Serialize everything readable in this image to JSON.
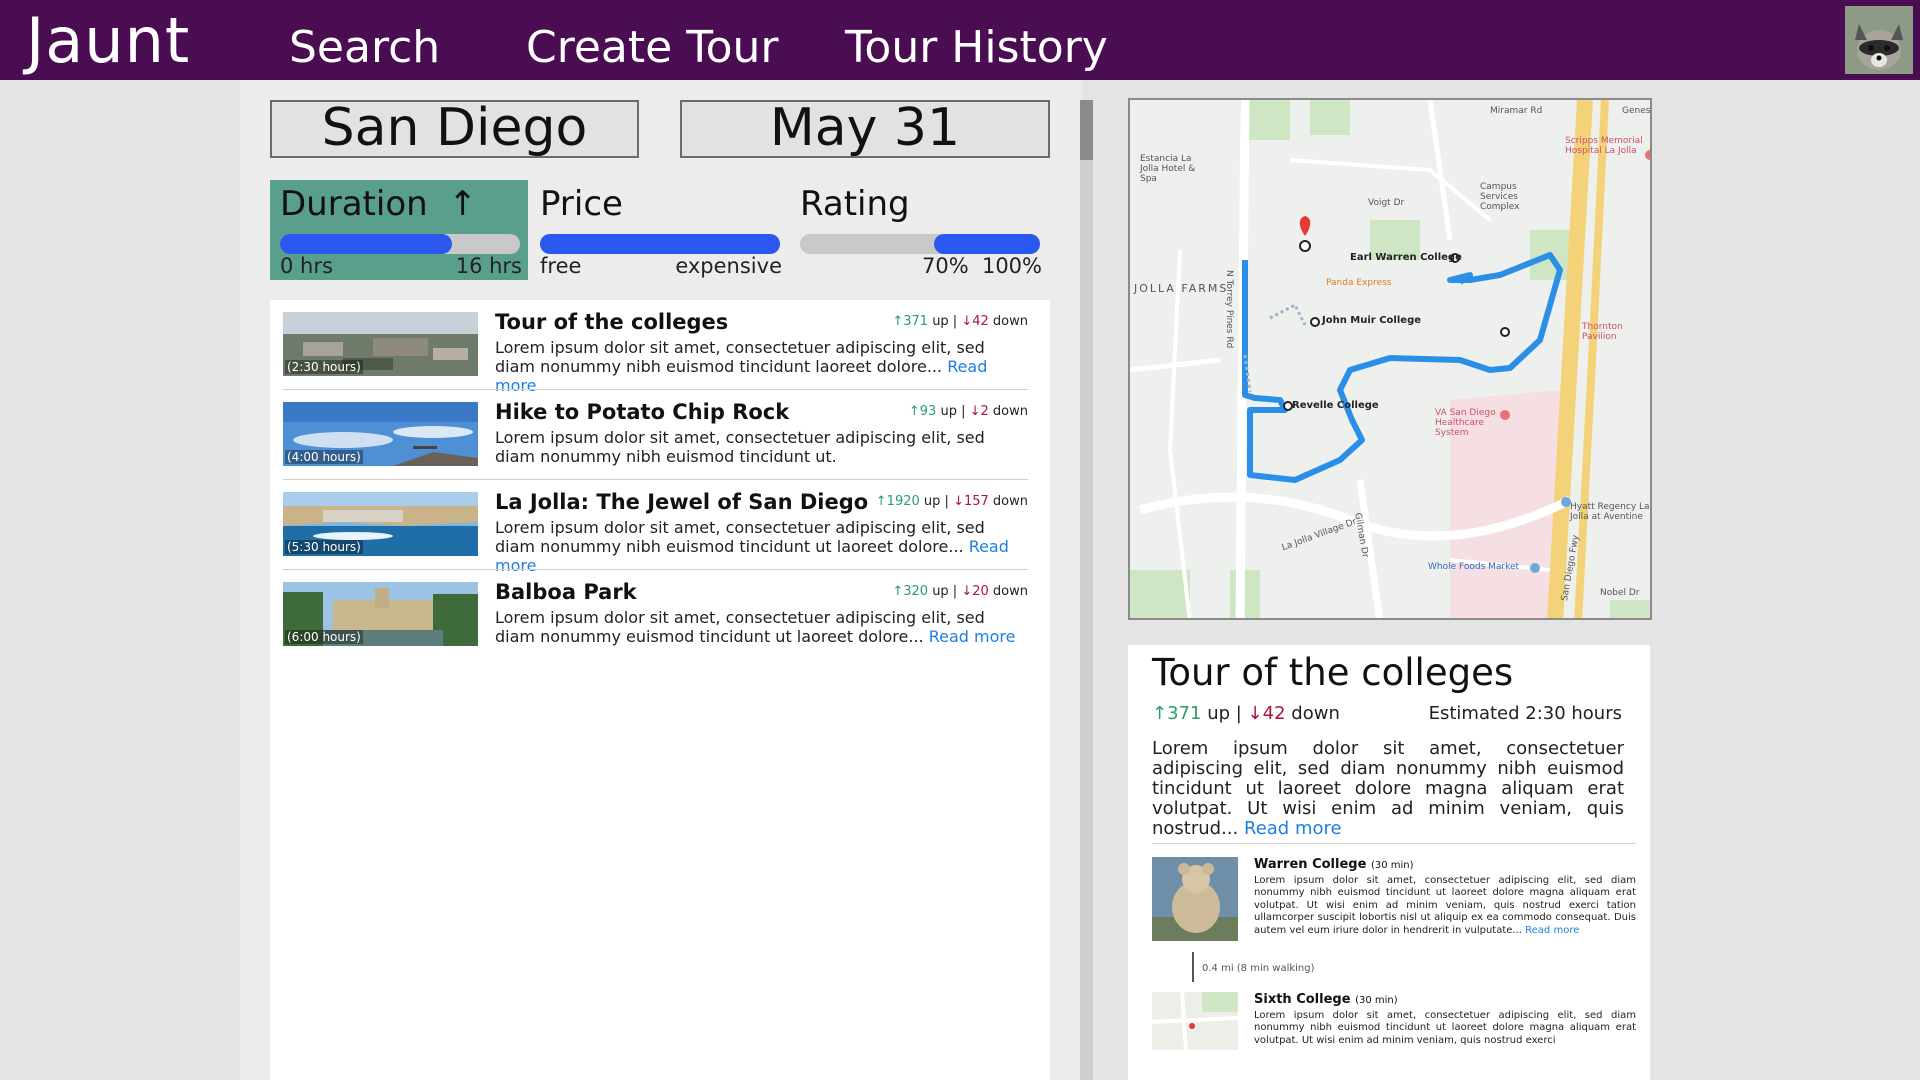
{
  "header": {
    "logo": "Jaunt",
    "nav": [
      "Search",
      "Create Tour",
      "Tour History"
    ]
  },
  "search": {
    "city": "San Diego",
    "date": "May 31"
  },
  "filters": {
    "duration": {
      "label": "Duration",
      "sort_icon": "arrow-up-icon",
      "min_label": "0 hrs",
      "max_label": "16 hrs",
      "range": [
        0,
        0.72
      ],
      "active": true
    },
    "price": {
      "label": "Price",
      "min_label": "free",
      "max_label": "expensive",
      "range": [
        0,
        1
      ]
    },
    "rating": {
      "label": "Rating",
      "min_label": "70%",
      "max_label": "100%",
      "range": [
        0.55,
        1
      ]
    }
  },
  "results": [
    {
      "title": "Tour of the colleges",
      "duration": "(2:30 hours)",
      "up": "↑371",
      "down": "↓42",
      "up_word": "up |",
      "down_word": "down",
      "desc": "Lorem ipsum dolor sit amet, consectetuer adipiscing elit, sed diam nonummy nibh euismod tincidunt laoreet dolore...",
      "read_more": "Read more"
    },
    {
      "title": "Hike to Potato Chip Rock",
      "duration": "(4:00 hours)",
      "up": "↑93",
      "down": "↓2",
      "up_word": "up |",
      "down_word": "down",
      "desc": "Lorem ipsum dolor sit amet, consectetuer adipiscing elit, sed diam nonummy nibh euismod tincidunt ut.",
      "read_more": ""
    },
    {
      "title": "La Jolla: The Jewel of San Diego",
      "duration": "(5:30 hours)",
      "up": "↑1920",
      "down": "↓157",
      "up_word": "up |",
      "down_word": "down",
      "desc": "Lorem ipsum dolor sit amet, consectetuer adipiscing elit, sed diam nonummy nibh euismod tincidunt ut laoreet dolore...",
      "read_more": "Read more"
    },
    {
      "title": "Balboa Park",
      "duration": "(6:00 hours)",
      "up": "↑320",
      "down": "↓20",
      "up_word": "up |",
      "down_word": "down",
      "desc": "Lorem ipsum dolor sit amet, consectetuer adipiscing elit, sed diam nonummy euismod tincidunt ut laoreet dolore...",
      "read_more": "Read more"
    }
  ],
  "map": {
    "labels": [
      "Earl Warren College",
      "John Muir College",
      "Revelle College",
      "Panda Express",
      "VA San Diego Healthcare System",
      "Estancia La Jolla Hotel & Spa",
      "Scripps Memorial Hospital La Jolla",
      "Campus Services Complex",
      "Thornton Pavilion",
      "Hyatt Regency La Jolla at Aventine",
      "Whole Foods Market",
      "JOLLA FARMS",
      "N Torrey Pines Rd",
      "Gilman Dr",
      "La Jolla Village Dr",
      "San Diego Fwy",
      "Nobel Dr",
      "Genesee",
      "Voigt Dr",
      "Miramar Rd"
    ],
    "route_color": "#2b8fe8"
  },
  "detail": {
    "title": "Tour of the colleges",
    "up": "↑371",
    "up_word": "up |",
    "down": "↓42",
    "down_word": "down",
    "estimated": "Estimated 2:30 hours",
    "desc": "Lorem ipsum dolor sit amet, consectetuer adipiscing elit, sed diam nonummy nibh euismod tincidunt ut laoreet dolore magna aliquam erat volutpat. Ut wisi enim ad minim veniam, quis nostrud...",
    "read_more": "Read more",
    "stops": [
      {
        "name": "Warren College",
        "duration": "(30 min)",
        "desc": "Lorem ipsum dolor sit amet, consectetuer adipiscing elit, sed diam nonummy nibh euismod tincidunt ut laoreet dolore magna aliquam erat volutpat. Ut wisi enim ad minim veniam, quis nostrud exerci tation ullamcorper suscipit lobortis nisl ut aliquip ex ea commodo consequat. Duis autem vel eum iriure dolor in hendrerit in vulputate...",
        "read_more": "Read more"
      },
      {
        "name": "Sixth College",
        "duration": "(30 min)",
        "desc": "Lorem ipsum dolor sit amet, consectetuer adipiscing elit, sed diam nonummy nibh euismod tincidunt ut laoreet dolore magna aliquam erat volutpat. Ut wisi enim ad minim veniam, quis nostrud exerci",
        "read_more": ""
      }
    ],
    "walk": "0.4 mi (8 min walking)"
  }
}
